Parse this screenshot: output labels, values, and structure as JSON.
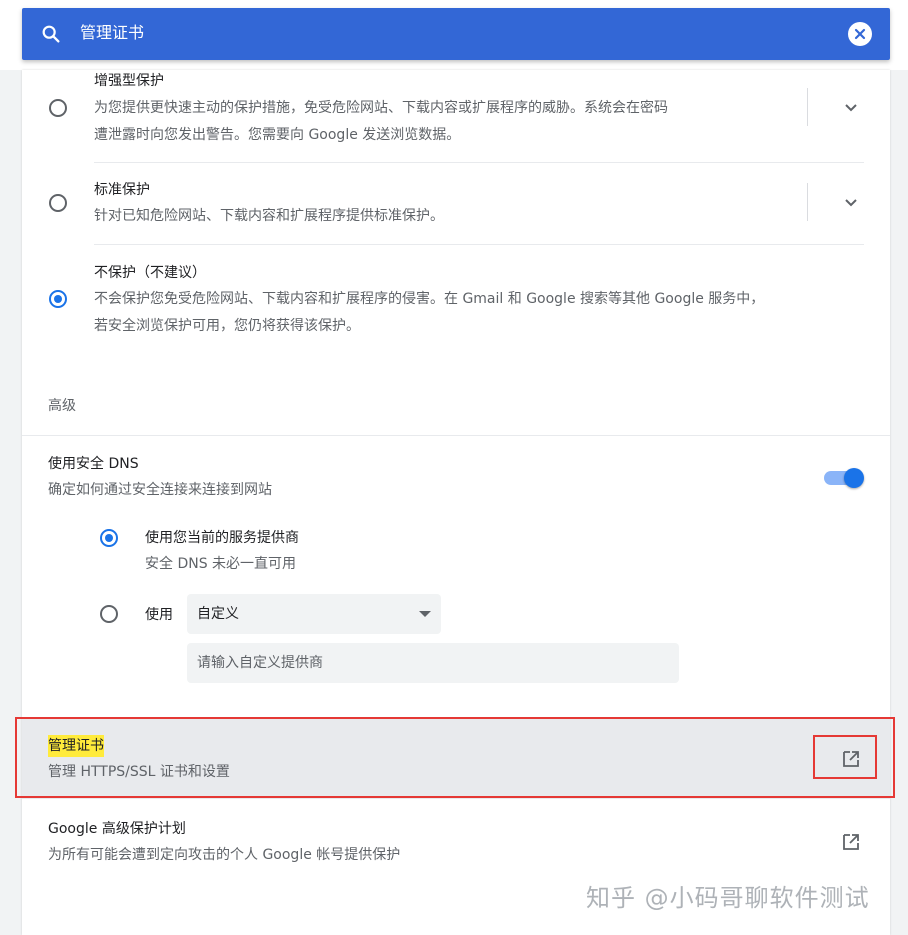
{
  "search": {
    "query": "管理证书",
    "icon": "search-icon",
    "clear_icon": "close-icon"
  },
  "safe_browsing": {
    "options": [
      {
        "title": "增强型保护",
        "desc_line1": "为您提供更快速主动的保护措施，免受危险网站、下载内容或扩展程序的威胁。系统会在密码",
        "desc_line2": "遭泄露时向您发出警告。您需要向 Google 发送浏览数据。",
        "checked": false
      },
      {
        "title": "标准保护",
        "desc_line1": "针对已知危险网站、下载内容和扩展程序提供标准保护。",
        "checked": false
      },
      {
        "title": "不保护（不建议）",
        "desc_line1": "不会保护您免受危险网站、下载内容和扩展程序的侵害。在 Gmail 和 Google 搜索等其他 Google 服务中，",
        "desc_line2": "若安全浏览保护可用，您仍将获得该保护。",
        "checked": true
      }
    ]
  },
  "advanced": {
    "heading": "高级",
    "secure_dns": {
      "title": "使用安全 DNS",
      "desc": "确定如何通过安全连接来连接到网站",
      "enabled": true,
      "current_provider": {
        "title": "使用您当前的服务提供商",
        "desc": "安全 DNS 未必一直可用",
        "checked": true
      },
      "custom": {
        "label": "使用",
        "selected": "自定义",
        "placeholder": "请输入自定义提供商",
        "checked": false
      }
    },
    "manage_certs": {
      "title": "管理证书",
      "desc": "管理 HTTPS/SSL 证书和设置",
      "icon": "external-link-icon"
    },
    "advanced_protection": {
      "title": "Google 高级保护计划",
      "desc": "为所有可能会遭到定向攻击的个人 Google 帐号提供保护",
      "icon": "external-link-icon"
    }
  },
  "watermark": "知乎 @小码哥聊软件测试",
  "colors": {
    "accent": "#1a73e8",
    "header": "#3367d6",
    "highlight": "#ffeb3b",
    "frame": "#e53935"
  }
}
